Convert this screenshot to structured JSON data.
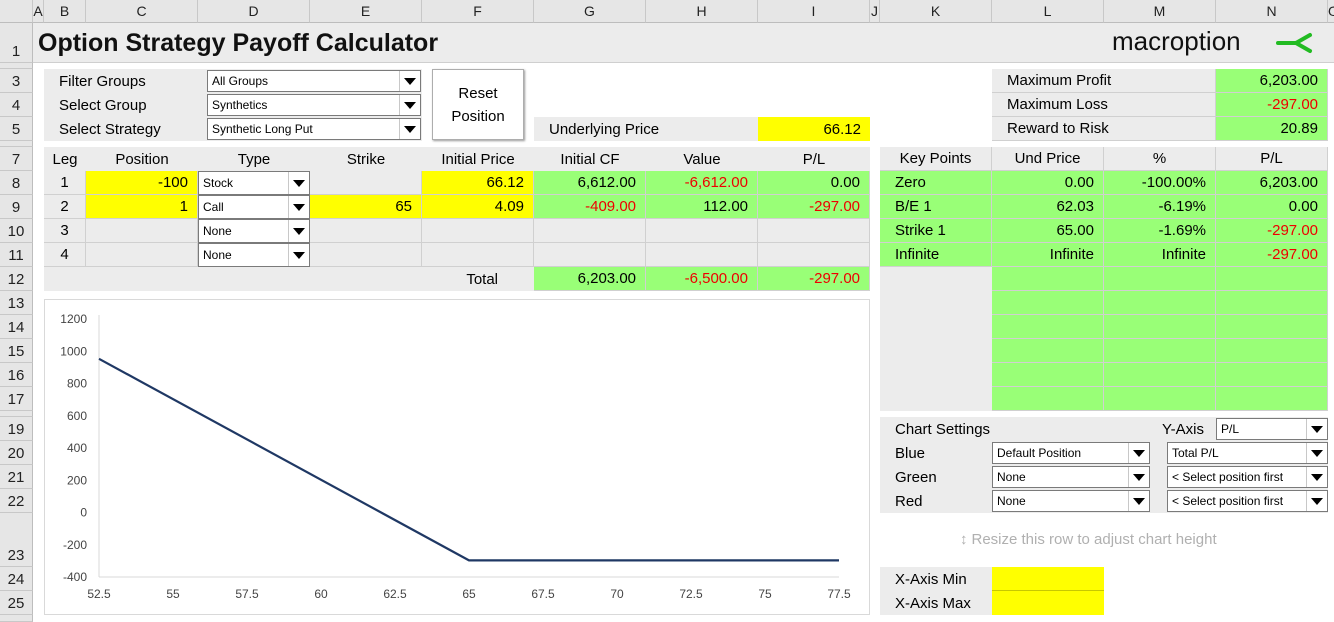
{
  "columns": [
    "A",
    "B",
    "C",
    "D",
    "E",
    "F",
    "G",
    "H",
    "I",
    "J",
    "K",
    "L",
    "M",
    "N",
    "O"
  ],
  "rows": [
    "1",
    "3",
    "4",
    "5",
    "7",
    "8",
    "9",
    "10",
    "11",
    "12",
    "13",
    "14",
    "15",
    "16",
    "17",
    "19",
    "20",
    "21",
    "22",
    "23",
    "24",
    "25"
  ],
  "title": "Option Strategy Payoff Calculator",
  "logo": {
    "text": "macroption"
  },
  "filters": [
    {
      "label": "Filter Groups",
      "value": "All Groups"
    },
    {
      "label": "Select Group",
      "value": "Synthetics"
    },
    {
      "label": "Select Strategy",
      "value": "Synthetic Long Put"
    }
  ],
  "reset_button": {
    "line1": "Reset",
    "line2": "Position"
  },
  "underlying": {
    "label": "Underlying Price",
    "value": "66.12"
  },
  "summary": [
    {
      "label": "Maximum Profit",
      "value": "6,203.00"
    },
    {
      "label": "Maximum Loss",
      "value": "-297.00"
    },
    {
      "label": "Reward to Risk",
      "value": "20.89"
    }
  ],
  "legs_table": {
    "headers": [
      "Leg",
      "Position",
      "Type",
      "Strike",
      "Initial Price",
      "Initial CF",
      "Value",
      "P/L"
    ],
    "rows": [
      {
        "leg": "1",
        "position": "-100",
        "type": "Stock",
        "strike": "",
        "initial_price": "66.12",
        "initial_cf": "6,612.00",
        "value": "-6,612.00",
        "pl": "0.00"
      },
      {
        "leg": "2",
        "position": "1",
        "type": "Call",
        "strike": "65",
        "initial_price": "4.09",
        "initial_cf": "-409.00",
        "value": "112.00",
        "pl": "-297.00"
      },
      {
        "leg": "3",
        "position": "",
        "type": "None",
        "strike": "",
        "initial_price": "",
        "initial_cf": "",
        "value": "",
        "pl": ""
      },
      {
        "leg": "4",
        "position": "",
        "type": "None",
        "strike": "",
        "initial_price": "",
        "initial_cf": "",
        "value": "",
        "pl": ""
      }
    ],
    "total": {
      "label": "Total",
      "initial_cf": "6,203.00",
      "value": "-6,500.00",
      "pl": "-297.00"
    }
  },
  "key_points": {
    "headers": [
      "Key Points",
      "Und Price",
      "%",
      "P/L"
    ],
    "rows": [
      {
        "label": "Zero",
        "und_price": "0.00",
        "pct": "-100.00%",
        "pl": "6,203.00"
      },
      {
        "label": "B/E 1",
        "und_price": "62.03",
        "pct": "-6.19%",
        "pl": "0.00"
      },
      {
        "label": "Strike 1",
        "und_price": "65.00",
        "pct": "-1.69%",
        "pl": "-297.00"
      },
      {
        "label": "Infinite",
        "und_price": "Infinite",
        "pct": "Infinite",
        "pl": "-297.00"
      }
    ]
  },
  "chart_settings": {
    "title": "Chart Settings",
    "y_axis_label": "Y-Axis",
    "y_axis_value": "P/L",
    "rows": [
      {
        "label": "Blue",
        "position": "Default Position",
        "measure": "Total P/L"
      },
      {
        "label": "Green",
        "position": "None",
        "measure": "< Select position first"
      },
      {
        "label": "Red",
        "position": "None",
        "measure": "< Select position first"
      }
    ]
  },
  "resize_hint": "Resize this row to adjust chart height",
  "x_axis": {
    "min_label": "X-Axis Min",
    "max_label": "X-Axis Max",
    "min_value": "",
    "max_value": ""
  },
  "colors": {
    "input": "#ffff00",
    "result": "#99ff77",
    "negative": "#ee0000",
    "line": "#1f3864",
    "accent": "#22bb22"
  },
  "chart_data": {
    "type": "line",
    "xlim": [
      52.5,
      77.5
    ],
    "ylim": [
      -400,
      1200
    ],
    "x_ticks": [
      "52.5",
      "55",
      "57.5",
      "60",
      "62.5",
      "65",
      "67.5",
      "70",
      "72.5",
      "75",
      "77.5"
    ],
    "y_ticks": [
      "1200",
      "1000",
      "800",
      "600",
      "400",
      "200",
      "0",
      "-200",
      "-400"
    ],
    "series": [
      {
        "x": [
          52.5,
          62.03,
          65,
          77.5
        ],
        "y": [
          953,
          0,
          -297,
          -297
        ]
      }
    ]
  }
}
